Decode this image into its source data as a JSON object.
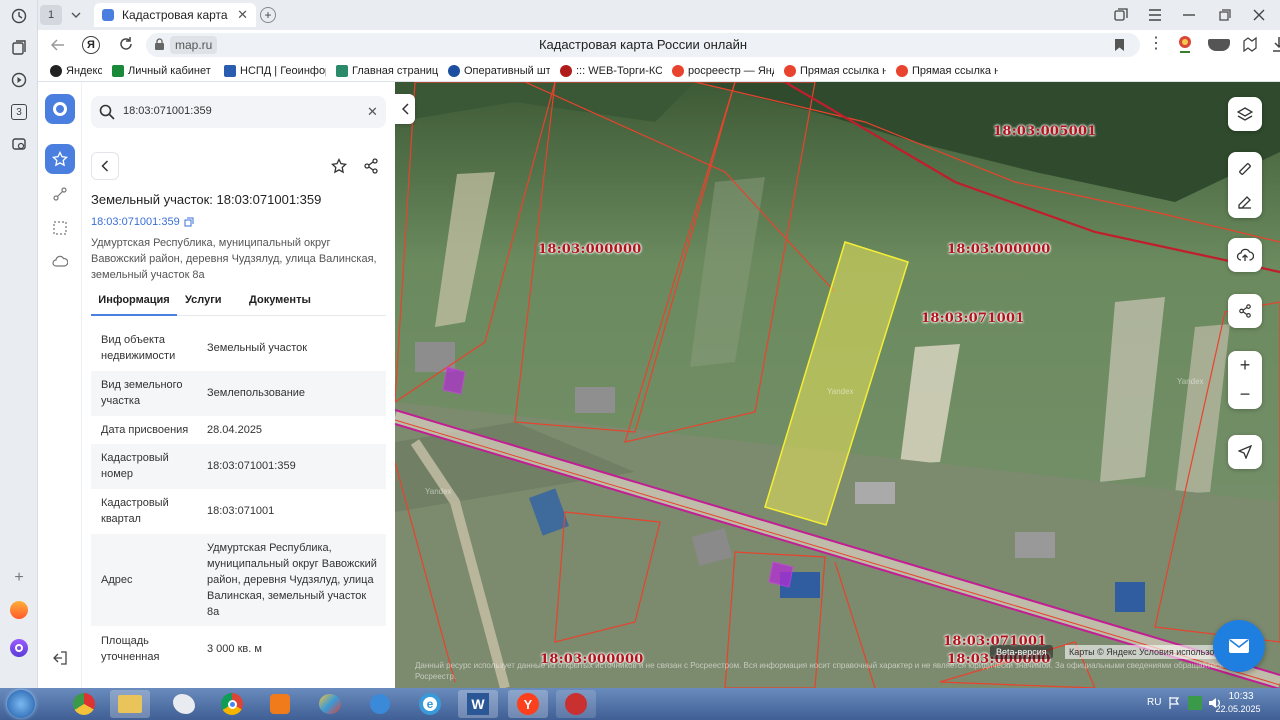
{
  "browser": {
    "tab_counter": "1",
    "tab_title": "Кадастровая карта Ро",
    "address": "map.ru",
    "page_title": "Кадастровая карта России онлайн",
    "bookmarks": [
      {
        "label": "Яндекс",
        "color": "#222222"
      },
      {
        "label": "Личный кабинет",
        "color": "#1a8a3a"
      },
      {
        "label": "НСПД | Геоинфор",
        "color": "#2a5db0"
      },
      {
        "label": "Главная страница",
        "color": "#2a8a6a"
      },
      {
        "label": "Оперативный шт",
        "color": "#1c4fa0"
      },
      {
        "label": "::: WEB-Торги-КС",
        "color": "#b01c1c"
      },
      {
        "label": "росреестр — Янд",
        "color": "#e8432c"
      },
      {
        "label": "Прямая ссылка на",
        "color": "#e8432c"
      },
      {
        "label": "Прямая ссылка на",
        "color": "#e8432c"
      }
    ],
    "rail_badge": "3"
  },
  "panel": {
    "search_value": "18:03:071001:359",
    "title": "Земельный участок: 18:03:071001:359",
    "cad_link": "18:03:071001:359",
    "address_line": "Удмуртская Республика, муниципальный округ Вавожский район, деревня Чудзялуд, улица Валинская, земельный участок 8а",
    "tabs": [
      "Информация",
      "Услуги",
      "Документы"
    ],
    "rows": [
      {
        "k": "Вид объекта недвижимости",
        "v": "Земельный участок"
      },
      {
        "k": "Вид земельного участка",
        "v": "Землепользование"
      },
      {
        "k": "Дата присвоения",
        "v": "28.04.2025"
      },
      {
        "k": "Кадастровый номер",
        "v": "18:03:071001:359"
      },
      {
        "k": "Кадастровый квартал",
        "v": "18:03:071001"
      },
      {
        "k": "Адрес",
        "v": "Удмуртская Республика, муниципальный округ Вавожский район, деревня Чудзялуд, улица Валинская, земельный участок 8а"
      },
      {
        "k": "Площадь уточненная",
        "v": "3 000 кв. м"
      }
    ]
  },
  "map": {
    "labels": [
      "18:03:005001",
      "18:03:000000",
      "18:03:000000",
      "18:03:071001",
      "18:03:000000",
      "18:03:071001",
      "18:03:000000"
    ],
    "watermark": "Yandex",
    "disclaimer": "Данный ресурс использует данные из открытых источников и не связан с Росреестром. Вся информация носит справочный характер и не является юридически значимой. За официальными сведениями обращайтесь в Росреестр.",
    "beta": "Beta-версия",
    "attribution": "Карты © Яндекс  Условия использования",
    "highlight_color": "#e8e45a"
  },
  "taskbar": {
    "lang": "RU",
    "time": "10:33",
    "date": "22.05.2025"
  }
}
